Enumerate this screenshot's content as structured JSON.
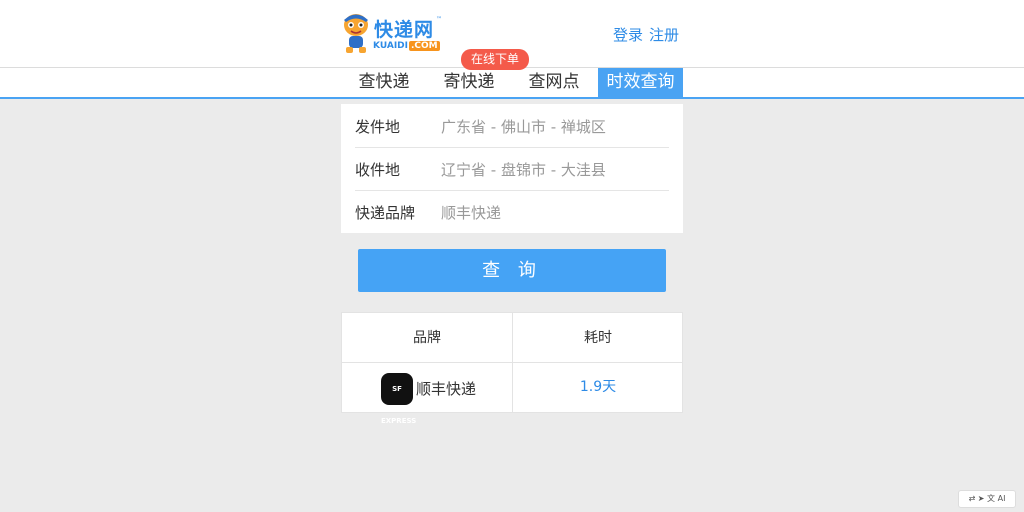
{
  "header": {
    "logo": {
      "name": "快递网",
      "tm": "™",
      "sub": "KUAIDI",
      "domain": ".COM"
    },
    "login": "登录",
    "register": "注册"
  },
  "nav": {
    "items": [
      {
        "label": "查快递"
      },
      {
        "label": "寄快递"
      },
      {
        "label": "查网点"
      },
      {
        "label": "时效查询"
      }
    ],
    "badge": "在线下单"
  },
  "form": {
    "origin_label": "发件地",
    "origin_value": "广东省 - 佛山市 - 禅城区",
    "dest_label": "收件地",
    "dest_value": "辽宁省 - 盘锦市 - 大洼县",
    "brand_label": "快递品牌",
    "brand_value": "顺丰快递"
  },
  "query_button": "查 询",
  "results": {
    "headers": [
      "品牌",
      "耗时"
    ],
    "rows": [
      {
        "brand": "顺丰快递",
        "logo_text": "SF EXPRESS",
        "time": "1.9天"
      }
    ]
  },
  "colors": {
    "accent": "#45a3f5",
    "badge": "#f45a4a",
    "link": "#2e8be6"
  }
}
